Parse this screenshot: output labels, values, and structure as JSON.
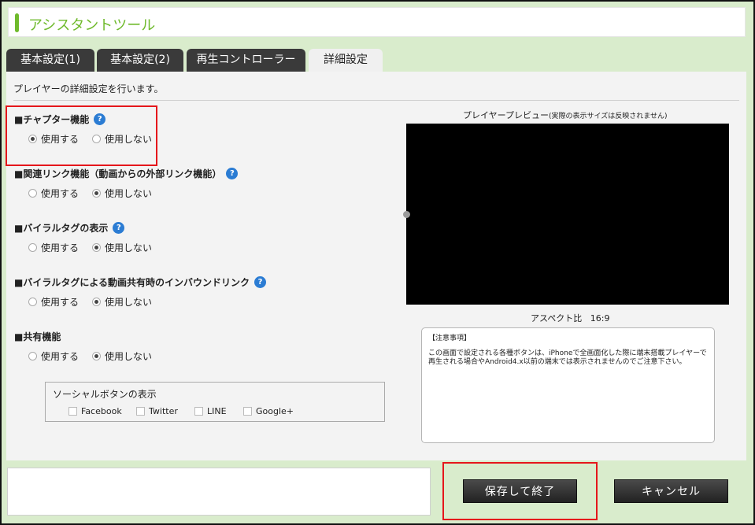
{
  "app": {
    "title": "アシスタントツール"
  },
  "tabs": [
    {
      "label": "基本設定(1)",
      "active": false
    },
    {
      "label": "基本設定(2)",
      "active": false
    },
    {
      "label": "再生コントローラー",
      "active": false
    },
    {
      "label": "詳細設定",
      "active": true
    }
  ],
  "description": "プレイヤーの詳細設定を行います。",
  "settings": [
    {
      "title": "■チャプター機能",
      "help": "?",
      "options": [
        "使用する",
        "使用しない"
      ],
      "selected": 0
    },
    {
      "title": "■関連リンク機能（動画からの外部リンク機能）",
      "help": "?",
      "options": [
        "使用する",
        "使用しない"
      ],
      "selected": 1
    },
    {
      "title": "■バイラルタグの表示",
      "help": "?",
      "options": [
        "使用する",
        "使用しない"
      ],
      "selected": 1
    },
    {
      "title": "■バイラルタグによる動画共有時のインバウンドリンク",
      "help": "?",
      "options": [
        "使用する",
        "使用しない"
      ],
      "selected": 1
    },
    {
      "title": "■共有機能",
      "help": "",
      "options": [
        "使用する",
        "使用しない"
      ],
      "selected": 1
    }
  ],
  "social": {
    "title": "ソーシャルボタンの表示",
    "buttons": [
      "Facebook",
      "Twitter",
      "LINE",
      "Google+"
    ]
  },
  "preview": {
    "label": "プレイヤープレビュー",
    "note": "(実際の表示サイズは反映されません)",
    "aspect_label": "アスペクト比",
    "aspect_value": "16:9"
  },
  "notice": {
    "title": "【注意事項】",
    "body": "この画面で設定される各種ボタンは、iPhoneで全画面化した際に端末搭載プレイヤーで再生される場合やAndroid4.x以前の端末では表示されませんのでご注意下さい。"
  },
  "footer": {
    "save_label": "保存して終了",
    "cancel_label": "キャンセル"
  },
  "colors": {
    "accent": "#6fba2c",
    "highlight": "#e5161b",
    "help": "#2b7cd3"
  }
}
